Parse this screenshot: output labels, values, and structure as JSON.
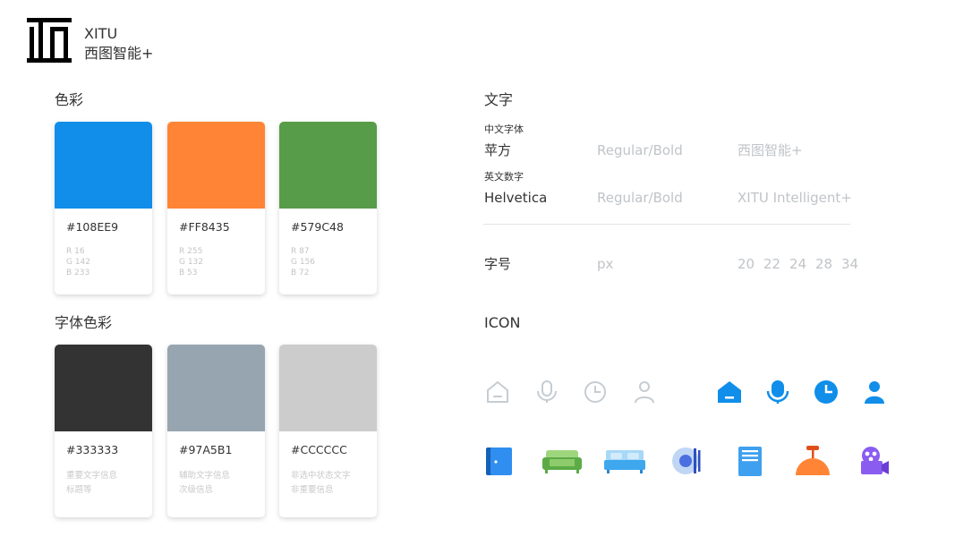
{
  "brand": {
    "name": "XITU",
    "subtitle": "西图智能+"
  },
  "colors_section": {
    "title": "色彩",
    "cards": [
      {
        "hex": "#108EE9",
        "r": "R 16",
        "g": "G 142",
        "b": "B 233"
      },
      {
        "hex": "#FF8435",
        "r": "R 255",
        "g": "G 132",
        "b": "B 53"
      },
      {
        "hex": "#579C48",
        "r": "R 87",
        "g": "G 156",
        "b": "B 72"
      }
    ]
  },
  "font_colors_section": {
    "title": "字体色彩",
    "cards": [
      {
        "hex": "#333333",
        "line1": "重要文字信息",
        "line2": "标题等"
      },
      {
        "hex": "#97A5B1",
        "line1": "辅助文字信息",
        "line2": "次级信息"
      },
      {
        "hex": "#CCCCCC",
        "line1": "非选中状态文字",
        "line2": "非重要信息"
      }
    ]
  },
  "typography": {
    "title": "文字",
    "chinese": {
      "label": "中文字体",
      "font": "苹方",
      "weights": "Regular/Bold",
      "sample": "西图智能+"
    },
    "english": {
      "label": "英文数字",
      "font": "Helvetica",
      "weights": "Regular/Bold",
      "sample": "XITU Intelligent+"
    },
    "sizes": {
      "label": "字号",
      "unit": "px",
      "values": [
        "20",
        "22",
        "24",
        "28",
        "34"
      ]
    }
  },
  "icon_section": {
    "title": "ICON"
  },
  "palette": {
    "blue": "#108EE9",
    "orange": "#FF8435",
    "green": "#579C48",
    "dark": "#333333",
    "gray": "#97A5B1",
    "light": "#CCCCCC"
  },
  "icons": {
    "outline": [
      "home-icon",
      "microphone-icon",
      "clock-icon",
      "user-icon"
    ],
    "filled": [
      "home-icon",
      "microphone-icon",
      "clock-icon",
      "user-icon"
    ],
    "devices": [
      "door-icon",
      "sofa-icon",
      "bed-icon",
      "speaker-icon",
      "cabinet-icon",
      "lamp-icon",
      "video-camera-icon"
    ]
  }
}
